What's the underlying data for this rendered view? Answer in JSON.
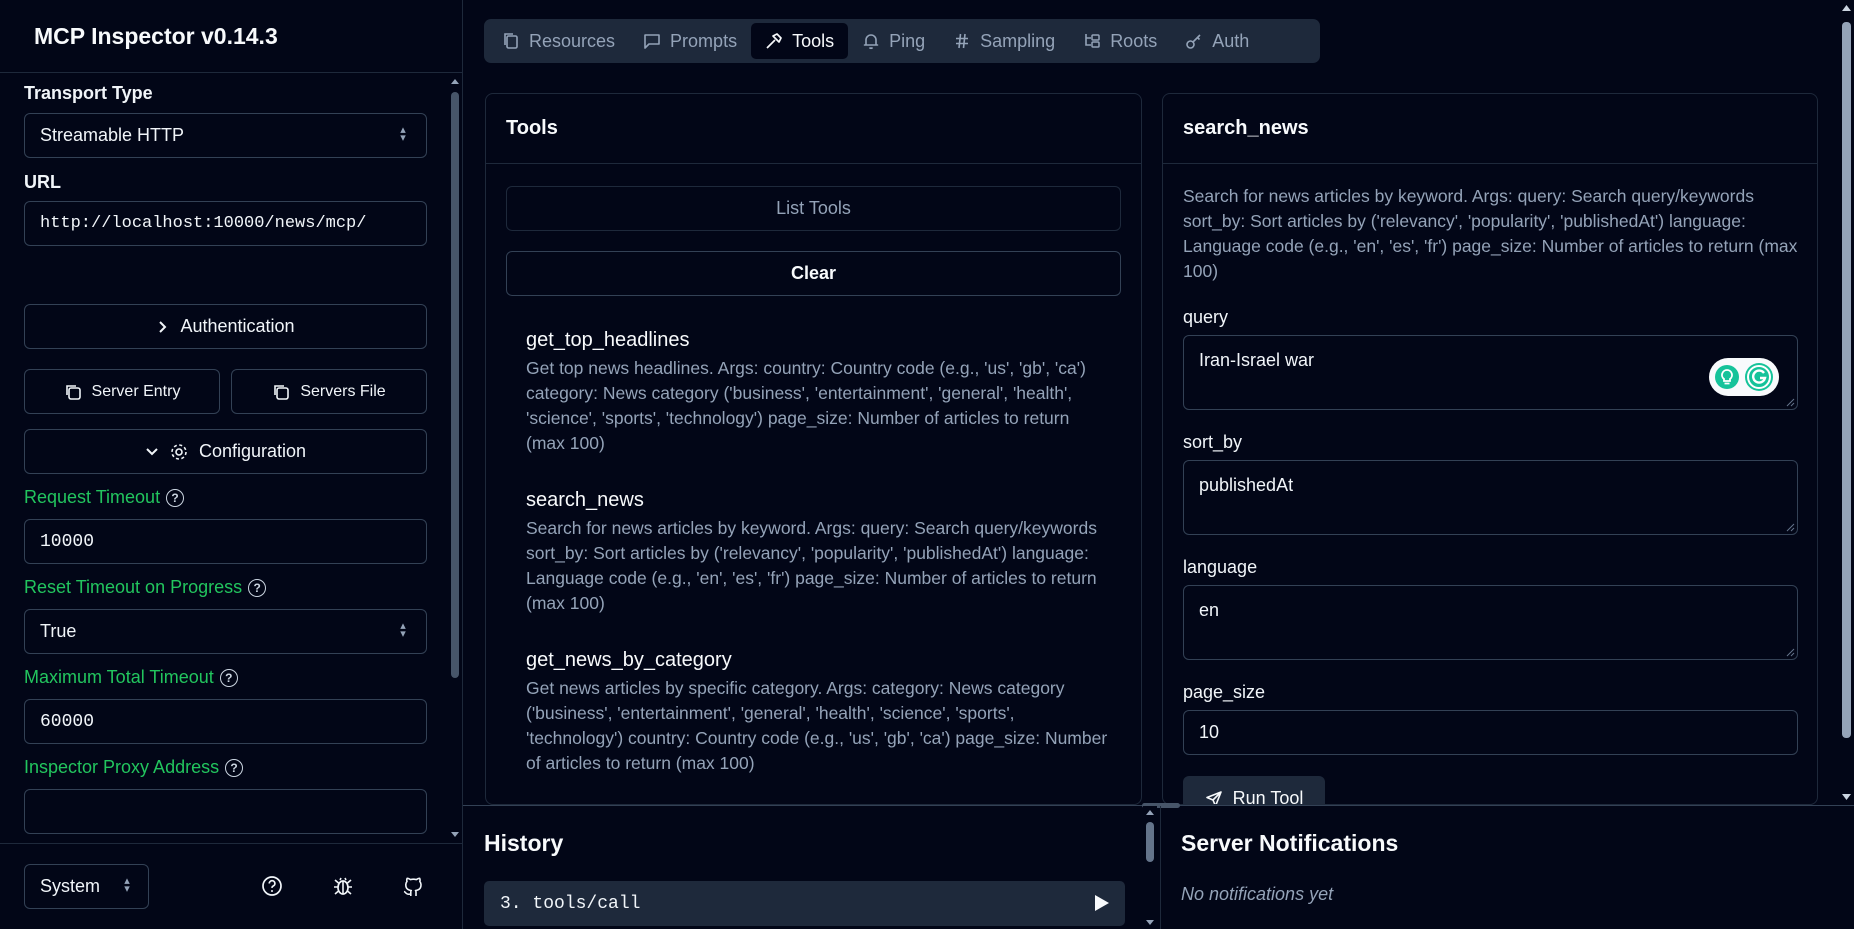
{
  "sidebar": {
    "title": "MCP Inspector v0.14.3",
    "transport_label": "Transport Type",
    "transport_value": "Streamable HTTP",
    "url_label": "URL",
    "url_value": "http://localhost:10000/news/mcp/",
    "auth_button": "Authentication",
    "server_entry_button": "Server Entry",
    "servers_file_button": "Servers File",
    "configuration_button": "Configuration",
    "request_timeout_label": "Request Timeout",
    "request_timeout_value": "10000",
    "reset_timeout_label": "Reset Timeout on Progress",
    "reset_timeout_value": "True",
    "max_timeout_label": "Maximum Total Timeout",
    "max_timeout_value": "60000",
    "proxy_label": "Inspector Proxy Address",
    "proxy_value": "",
    "theme_value": "System"
  },
  "tabs": [
    {
      "label": "Resources",
      "icon": "files-icon"
    },
    {
      "label": "Prompts",
      "icon": "message-square-icon"
    },
    {
      "label": "Tools",
      "icon": "hammer-icon",
      "active": true
    },
    {
      "label": "Ping",
      "icon": "bell-icon"
    },
    {
      "label": "Sampling",
      "icon": "hash-icon"
    },
    {
      "label": "Roots",
      "icon": "folder-tree-icon"
    },
    {
      "label": "Auth",
      "icon": "key-icon"
    }
  ],
  "tools_panel": {
    "title": "Tools",
    "list_button": "List Tools",
    "clear_button": "Clear",
    "items": [
      {
        "name": "get_top_headlines",
        "description": "Get top news headlines. Args: country: Country code (e.g., 'us', 'gb', 'ca') category: News category ('business', 'entertainment', 'general', 'health', 'science', 'sports', 'technology') page_size: Number of articles to return (max 100)"
      },
      {
        "name": "search_news",
        "description": "Search for news articles by keyword. Args: query: Search query/keywords sort_by: Sort articles by ('relevancy', 'popularity', 'publishedAt') language: Language code (e.g., 'en', 'es', 'fr') page_size: Number of articles to return (max 100)"
      },
      {
        "name": "get_news_by_category",
        "description": "Get news articles by specific category. Args: category: News category ('business', 'entertainment', 'general', 'health', 'science', 'sports', 'technology') country: Country code (e.g., 'us', 'gb', 'ca') page_size: Number of articles to return (max 100)"
      }
    ]
  },
  "detail_panel": {
    "title": "search_news",
    "description": "Search for news articles by keyword. Args: query: Search query/keywords sort_by: Sort articles by ('relevancy', 'popularity', 'publishedAt') language: Language code (e.g., 'en', 'es', 'fr') page_size: Number of articles to return (max 100)",
    "fields": [
      {
        "label": "query",
        "value": "Iran-Israel war"
      },
      {
        "label": "sort_by",
        "value": "publishedAt"
      },
      {
        "label": "language",
        "value": "en"
      },
      {
        "label": "page_size",
        "value": "10"
      }
    ],
    "run_button": "Run Tool"
  },
  "history": {
    "title": "History",
    "items": [
      {
        "label": "3. tools/call"
      }
    ]
  },
  "notifications": {
    "title": "Server Notifications",
    "empty_text": "No notifications yet"
  },
  "colors": {
    "background": "#020617",
    "border": "#1e293b",
    "accent_green": "#22c55e",
    "muted_text": "#94a3b8"
  }
}
